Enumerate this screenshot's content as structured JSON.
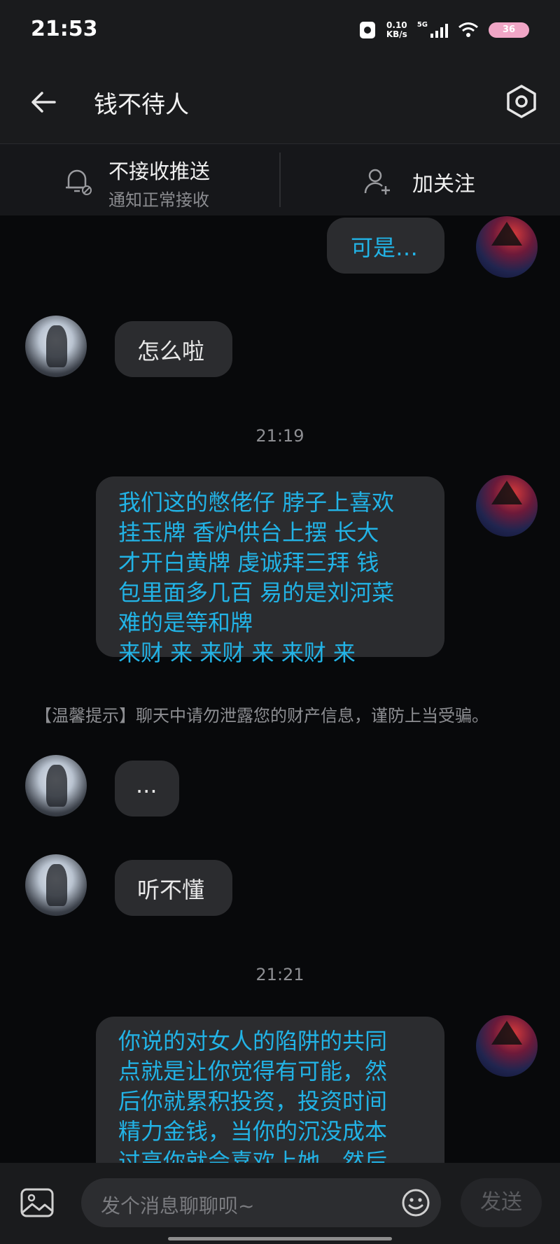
{
  "status_bar": {
    "time": "21:53",
    "net_speed_value": "0.10",
    "net_speed_unit": "KB/s",
    "network": "5G",
    "battery_label": "36"
  },
  "header": {
    "title": "钱不待人",
    "back_icon": "arrow-left-icon",
    "settings_icon": "hexagon-settings-icon"
  },
  "actions": {
    "mute": {
      "title": "不接收推送",
      "subtitle": "通知正常接收",
      "icon": "bell-off-icon"
    },
    "follow": {
      "label": "加关注",
      "icon": "add-user-icon"
    }
  },
  "messages": [
    {
      "from": "me",
      "text": "可是…"
    },
    {
      "from": "other",
      "text": "怎么啦"
    },
    {
      "type": "timestamp",
      "text": "21:19"
    },
    {
      "from": "me",
      "lines": [
        "我们这的憋佬仔 脖子上喜欢",
        "挂玉牌 香炉供台上摆 长大",
        "才开白黄牌 虔诚拜三拜 钱",
        "包里面多几百 易的是刘河菜",
        "难的是等和牌",
        "来财 来 来财 来 来财 来"
      ]
    },
    {
      "type": "tip",
      "text": "【温馨提示】聊天中请勿泄露您的财产信息，谨防上当受骗。"
    },
    {
      "from": "other",
      "text": "..."
    },
    {
      "from": "other",
      "text": "听不懂"
    },
    {
      "type": "timestamp",
      "text": "21:21"
    },
    {
      "from": "me",
      "lines": [
        "你说的对女人的陷阱的共同",
        "点就是让你觉得有可能，然",
        "后你就累积投资，投资时间",
        "精力金钱，当你的沉没成本",
        "过高你就会喜欢上她，然后"
      ]
    }
  ],
  "input_bar": {
    "placeholder": "发个消息聊聊呗~",
    "send_label": "发送",
    "image_icon": "image-icon",
    "emoji_icon": "emoji-icon"
  },
  "colors": {
    "background": "#08090b",
    "bar": "#1a1b1d",
    "bubble": "#2b2c2f",
    "my_text": "#22b3e6",
    "other_text": "#e8e8e8"
  }
}
